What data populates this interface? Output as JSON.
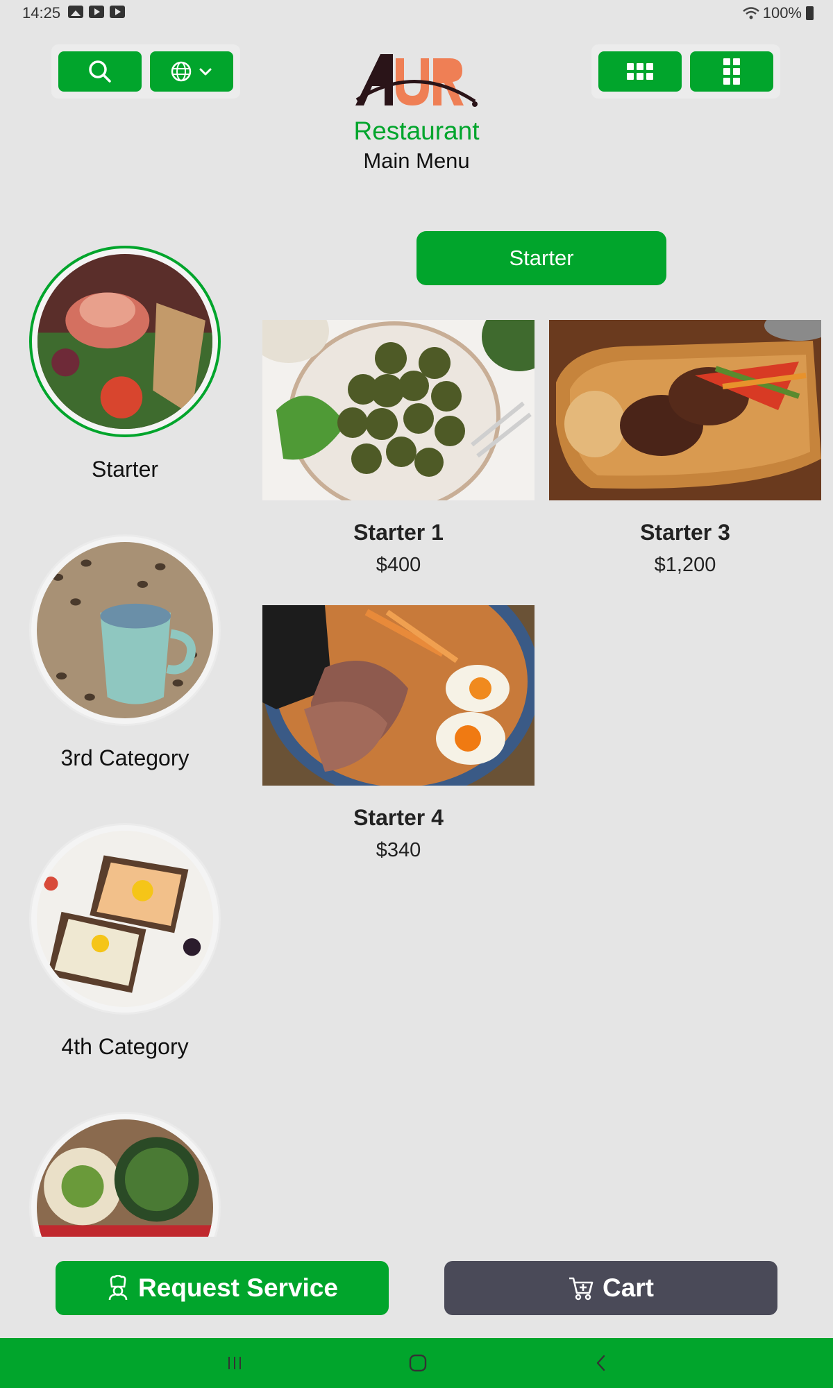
{
  "status_bar": {
    "time": "14:25",
    "battery": "100%"
  },
  "header": {
    "brand": "Restaurant",
    "subtitle": "Main Menu"
  },
  "categories": [
    {
      "label": "Starter",
      "active": true
    },
    {
      "label": "3rd Category",
      "active": false
    },
    {
      "label": "4th Category",
      "active": false
    },
    {
      "label": "",
      "active": false
    }
  ],
  "section": {
    "title": "Starter"
  },
  "products": [
    {
      "name": "Starter 1",
      "price": "$400"
    },
    {
      "name": "Starter 3",
      "price": "$1,200"
    },
    {
      "name": "Starter 4",
      "price": "$340"
    }
  ],
  "actions": {
    "request_service": "Request Service",
    "cart": "Cart"
  },
  "colors": {
    "accent": "#01a52c",
    "cart": "#4a4a58",
    "background": "#e5e5e5",
    "logo_orange": "#ef7f55",
    "logo_dark": "#2a1418"
  }
}
